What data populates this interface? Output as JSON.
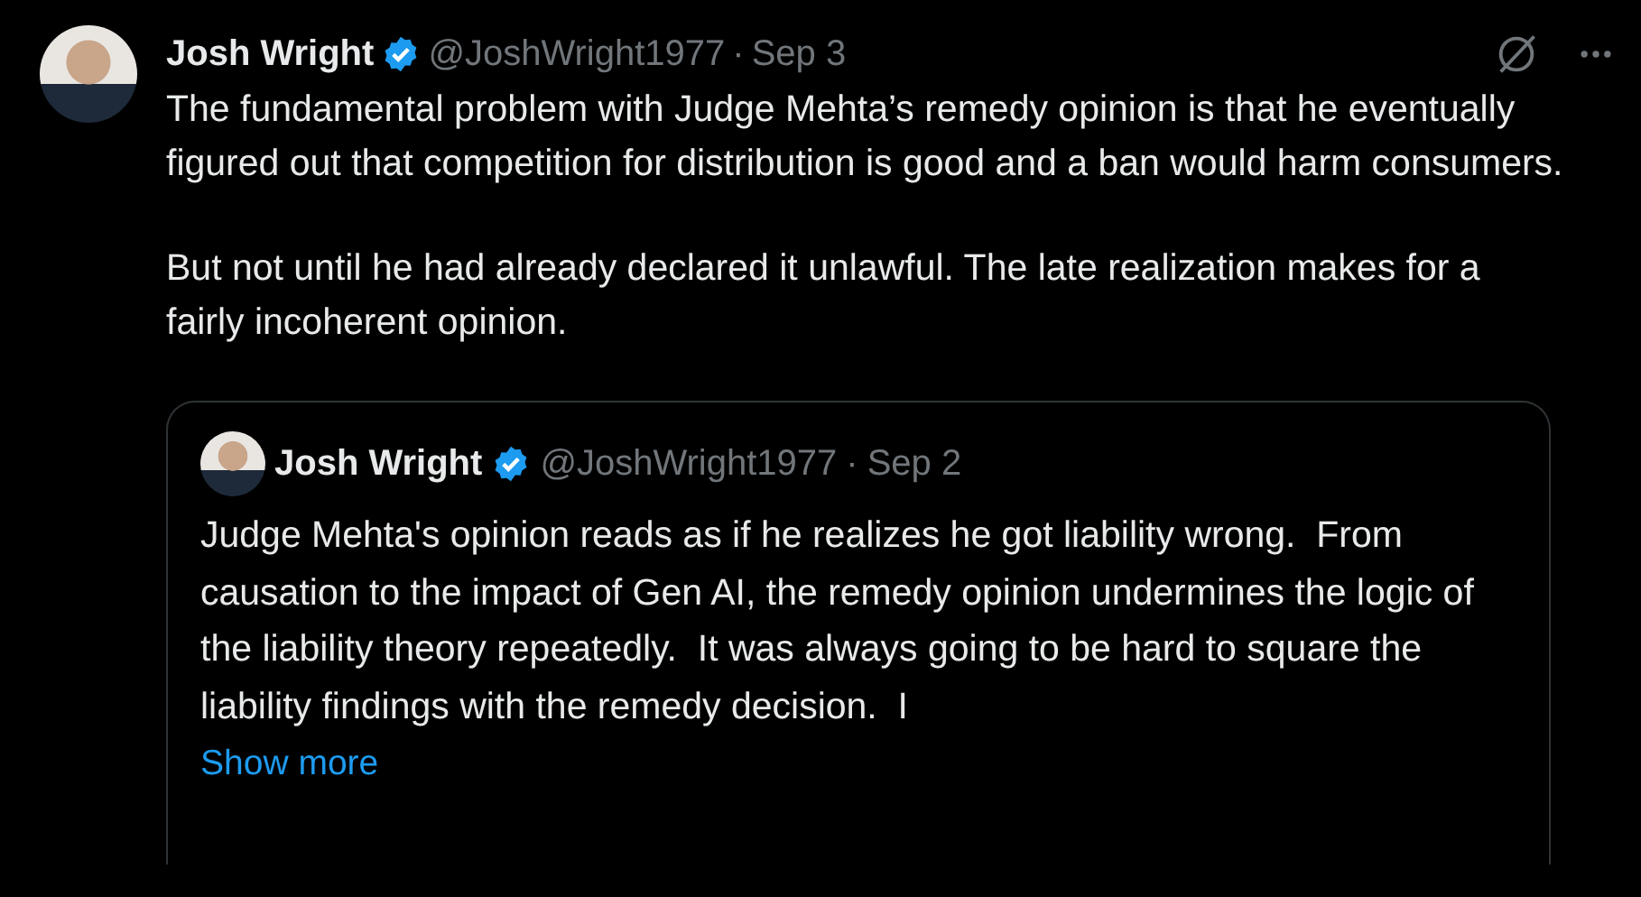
{
  "post": {
    "author": {
      "name": "Josh Wright",
      "verified": true,
      "handle": "@JoshWright1977",
      "separator": "·",
      "date": "Sep 3"
    },
    "paragraphs": [
      "The fundamental problem with Judge Mehta’s remedy opinion is that he eventually figured out that competition for distribution is good and a ban would harm consumers.",
      "But not until he had already declared it unlawful. The late realization makes for a fairly incoherent opinion."
    ],
    "quote": {
      "author": {
        "name": "Josh Wright",
        "verified": true,
        "handle": "@JoshWright1977",
        "separator": "·",
        "date": "Sep 2"
      },
      "text": "Judge Mehta's opinion reads as if he realizes he got liability wrong.  From causation to the impact of Gen AI, the remedy opinion undermines the logic of the liability theory repeatedly.  It was always going to be hard to square the liability findings with the remedy decision.  I",
      "show_more": "Show more"
    }
  }
}
